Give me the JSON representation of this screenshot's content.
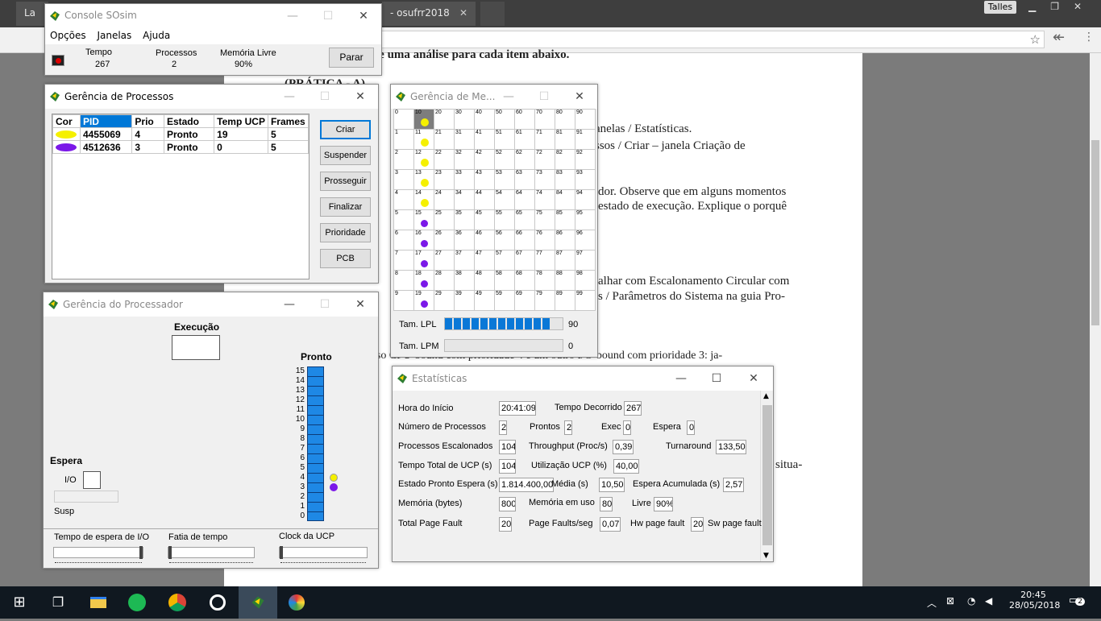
{
  "browser": {
    "tabs": [
      {
        "label": "La"
      },
      {
        "label": "- osufrr2018"
      }
    ],
    "profile": "Talles"
  },
  "document": {
    "lines": [
      "tado do simulador e uma análise para cada item abaixo.",
      "(PRÁTICA - A)",
      "anelas / Estatísticas.",
      "ssos / Criar – janela Criação de",
      "dor. Observe que em alguns momentos",
      "estado de execução. Explique o porquê",
      "alhar com Escalonamento Circular com",
      "s / Parâmetros do Sistema na guia Pro-",
      "ocesso CPU-bound com prioridade 4 e um outro I/O-bound com prioridade 3: ja-",
      "situa-"
    ]
  },
  "console": {
    "title": "Console SOsim",
    "menu": [
      "Opções",
      "Janelas",
      "Ajuda"
    ],
    "tempo_label": "Tempo",
    "tempo": "267",
    "processos_label": "Processos",
    "processos": "2",
    "memoria_label": "Memória Livre",
    "memoria": "90%",
    "parar": "Parar"
  },
  "processos": {
    "title": "Gerência de Processos",
    "headers": [
      "Cor",
      "PID",
      "Prio",
      "Estado",
      "Temp UCP",
      "Frames"
    ],
    "rows": [
      {
        "pid": "4455069",
        "prio": "4",
        "estado": "Pronto",
        "ucp": "19",
        "frames": "5",
        "color": "#f5f000"
      },
      {
        "pid": "4512636",
        "prio": "3",
        "estado": "Pronto",
        "ucp": "0",
        "frames": "5",
        "color": "#7b18e8"
      }
    ],
    "buttons": {
      "criar": "Criar",
      "suspender": "Suspender",
      "prosseguir": "Prosseguir",
      "finalizar": "Finalizar",
      "prioridade": "Prioridade",
      "pcb": "PCB"
    }
  },
  "memoria": {
    "title": "Gerência de Me...",
    "lpl_label": "Tam. LPL",
    "lpl": "90",
    "lpl_fill": 0.9,
    "lpm_label": "Tam. LPM",
    "lpm": "0"
  },
  "processador": {
    "title": "Gerência do Processador",
    "execucao": "Execução",
    "pronto": "Pronto",
    "prio_levels": [
      "15",
      "14",
      "13",
      "12",
      "11",
      "10",
      "9",
      "8",
      "7",
      "6",
      "5",
      "4",
      "3",
      "2",
      "1",
      "0"
    ],
    "espera": "Espera",
    "io": "I/O",
    "susp": "Susp",
    "slider1": "Tempo de espera de I/O",
    "slider2": "Fatia de tempo",
    "slider3": "Clock da UCP"
  },
  "estatisticas": {
    "title": "Estatísticas",
    "hora_inicio_label": "Hora do Início",
    "hora_inicio": "20:41:09",
    "tempo_decorrido_label": "Tempo Decorrido",
    "tempo_decorrido": "267",
    "num_proc_label": "Número de Processos",
    "num_proc": "2",
    "prontos_label": "Prontos",
    "prontos": "2",
    "exec_label": "Exec",
    "exec": "0",
    "espera_label": "Espera",
    "espera": "0",
    "escalonados_label": "Processos Escalonados",
    "escalonados": "104",
    "throughput_label": "Throughput (Proc/s)",
    "throughput": "0,39",
    "turnaround_label": "Turnaround",
    "turnaround": "133,50",
    "tempo_ucp_label": "Tempo Total de UCP (s)",
    "tempo_ucp": "104",
    "util_label": "Utilização UCP (%)",
    "util": "40,00",
    "pronto_espera_label": "Estado Pronto Espera (s)",
    "pronto_espera": "1.814.400,00",
    "media_label": "Média (s)",
    "media": "10,50",
    "espera_acum_label": "Espera Acumulada (s)",
    "espera_acum": "2,57",
    "memoria_label": "Memória (bytes)",
    "memoria": "800",
    "mem_uso_label": "Memória em uso",
    "mem_uso": "80",
    "livre_label": "Livre",
    "livre": "90%",
    "page_fault_label": "Total Page Fault",
    "page_fault": "20",
    "pf_seg_label": "Page Faults/seg",
    "pf_seg": "0,07",
    "hw_pf_label": "Hw page fault",
    "hw_pf": "20",
    "sw_pf_label": "Sw page fault"
  },
  "taskbar": {
    "time": "20:45",
    "date": "28/05/2018",
    "notif": "2"
  }
}
